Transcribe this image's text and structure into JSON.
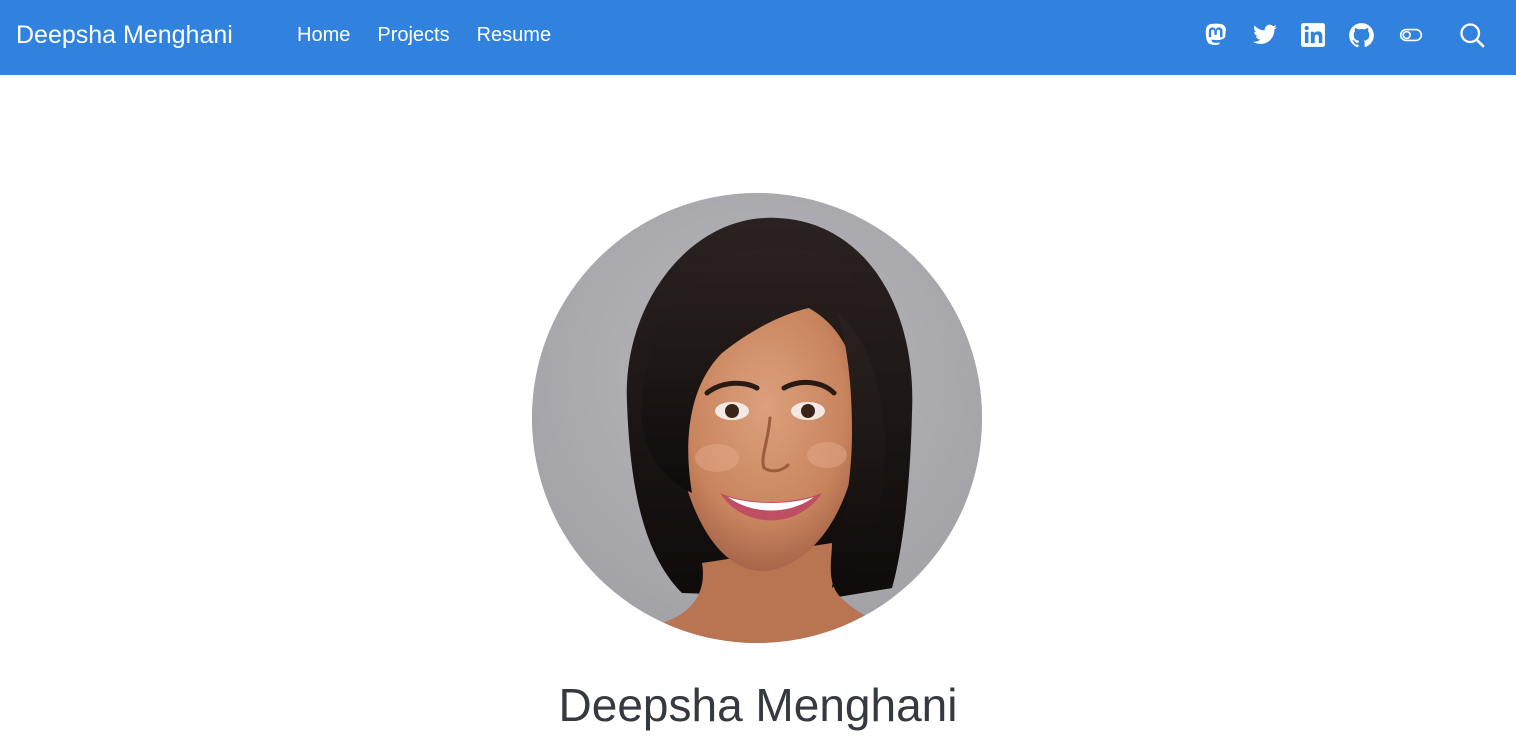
{
  "header": {
    "brand": "Deepsha Menghani",
    "nav": [
      {
        "label": "Home"
      },
      {
        "label": "Projects"
      },
      {
        "label": "Resume"
      }
    ],
    "icons": [
      "mastodon-icon",
      "twitter-icon",
      "linkedin-icon",
      "github-icon",
      "theme-toggle-icon",
      "search-icon"
    ],
    "bg_color": "#3182de"
  },
  "hero": {
    "name": "Deepsha Menghani",
    "photo": "portrait-photo"
  }
}
